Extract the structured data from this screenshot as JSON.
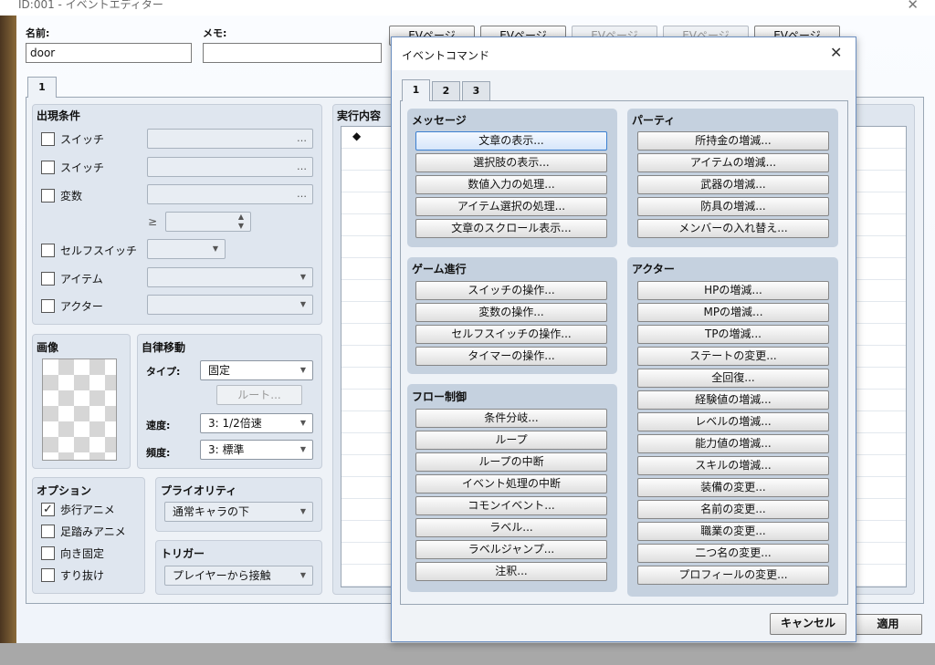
{
  "window": {
    "title": "ID:001 - イベントエディター",
    "close_glyph": "✕"
  },
  "fields": {
    "name_label": "名前:",
    "name_value": "door",
    "memo_label": "メモ:",
    "memo_value": ""
  },
  "page_tabs": [
    "EVページ",
    "EVページ",
    "EVページ",
    "EVページ",
    "EVページ"
  ],
  "tab": "1",
  "conditions": {
    "title": "出現条件",
    "items": [
      {
        "label": "スイッチ",
        "control": "…"
      },
      {
        "label": "スイッチ",
        "control": "…"
      },
      {
        "label": "変数",
        "control": "…"
      }
    ],
    "ge": "≥",
    "self_switch": "セルフスイッチ",
    "item": "アイテム",
    "actor": "アクター"
  },
  "image": {
    "title": "画像"
  },
  "autonomous": {
    "title": "自律移動",
    "type_label": "タイプ:",
    "type_value": "固定",
    "route_button": "ルート...",
    "speed_label": "速度:",
    "speed_value": "3: 1/2倍速",
    "freq_label": "頻度:",
    "freq_value": "3: 標準"
  },
  "options": {
    "title": "オプション",
    "walk": "歩行アニメ",
    "step": "足踏みアニメ",
    "dir_fix": "向き固定",
    "through": "すり抜け",
    "walk_checked": true
  },
  "priority": {
    "title": "プライオリティ",
    "value": "通常キャラの下"
  },
  "trigger": {
    "title": "トリガー",
    "value": "プレイヤーから接触"
  },
  "contents": {
    "title": "実行内容",
    "first_row": "◆"
  },
  "editor_buttons": {
    "apply": "適用"
  },
  "dialog": {
    "title": "イベントコマンド",
    "close_glyph": "✕",
    "tabs": [
      "1",
      "2",
      "3"
    ],
    "message": {
      "title": "メッセージ",
      "items": [
        "文章の表示...",
        "選択肢の表示...",
        "数値入力の処理...",
        "アイテム選択の処理...",
        "文章のスクロール表示..."
      ]
    },
    "party": {
      "title": "パーティ",
      "items": [
        "所持金の増減...",
        "アイテムの増減...",
        "武器の増減...",
        "防具の増減...",
        "メンバーの入れ替え..."
      ]
    },
    "progress": {
      "title": "ゲーム進行",
      "items": [
        "スイッチの操作...",
        "変数の操作...",
        "セルフスイッチの操作...",
        "タイマーの操作..."
      ]
    },
    "flow": {
      "title": "フロー制御",
      "items": [
        "条件分岐...",
        "ループ",
        "ループの中断",
        "イベント処理の中断",
        "コモンイベント...",
        "ラベル...",
        "ラベルジャンプ...",
        "注釈..."
      ]
    },
    "actor": {
      "title": "アクター",
      "items": [
        "HPの増減...",
        "MPの増減...",
        "TPの増減...",
        "ステートの変更...",
        "全回復...",
        "経験値の増減...",
        "レベルの増減...",
        "能力値の増減...",
        "スキルの増減...",
        "装備の変更...",
        "名前の変更...",
        "職業の変更...",
        "二つ名の変更...",
        "プロフィールの変更..."
      ]
    },
    "cancel": "キャンセル"
  }
}
